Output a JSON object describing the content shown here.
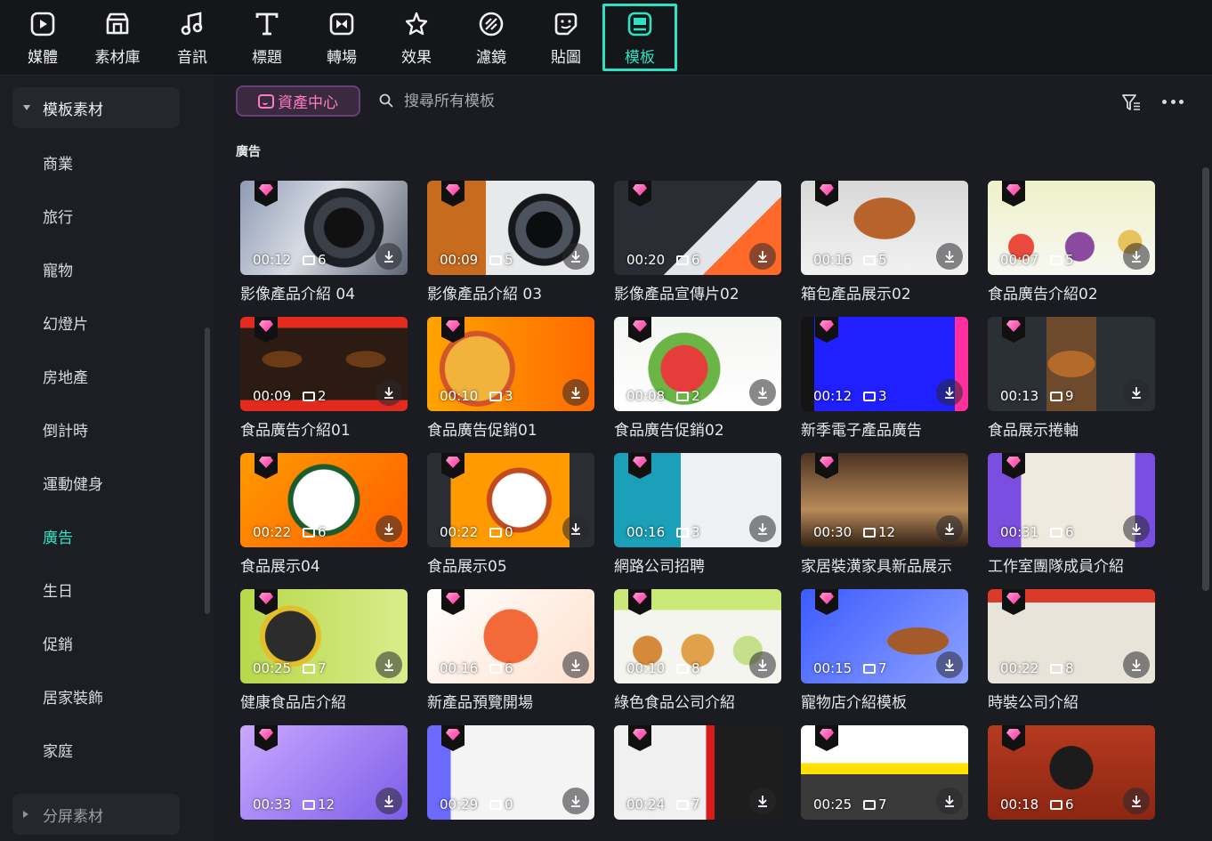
{
  "tabs": [
    {
      "label": "媒體",
      "icon": "media-icon"
    },
    {
      "label": "素材庫",
      "icon": "stock-library-icon"
    },
    {
      "label": "音訊",
      "icon": "audio-icon"
    },
    {
      "label": "標題",
      "icon": "title-icon"
    },
    {
      "label": "轉場",
      "icon": "transition-icon"
    },
    {
      "label": "效果",
      "icon": "effects-icon"
    },
    {
      "label": "濾鏡",
      "icon": "filter-icon"
    },
    {
      "label": "貼圖",
      "icon": "sticker-icon"
    },
    {
      "label": "模板",
      "icon": "template-icon",
      "active": true
    }
  ],
  "sidebar": {
    "header": "模板素材",
    "items": [
      "商業",
      "旅行",
      "寵物",
      "幻燈片",
      "房地產",
      "倒計時",
      "運動健身",
      "廣告",
      "生日",
      "促銷",
      "居家裝飾",
      "家庭"
    ],
    "active_item": "廣告",
    "footer": "分屏素材"
  },
  "toolbar": {
    "asset_center": "資產中心",
    "search_placeholder": "搜尋所有模板"
  },
  "section_title": "廣告",
  "colors": {
    "accent": "#2fe1c3",
    "premium": "#ff2f9e"
  },
  "cards": [
    {
      "title": "影像產品介紹 04",
      "duration": "00:12",
      "clips": "6"
    },
    {
      "title": "影像產品介紹 03",
      "duration": "00:09",
      "clips": "5"
    },
    {
      "title": "影像產品宣傳片02",
      "duration": "00:20",
      "clips": "6"
    },
    {
      "title": "箱包產品展示02",
      "duration": "00:16",
      "clips": "5"
    },
    {
      "title": "食品廣告介紹02",
      "duration": "00:07",
      "clips": "5"
    },
    {
      "title": "食品廣告介紹01",
      "duration": "00:09",
      "clips": "2"
    },
    {
      "title": "食品廣告促銷01",
      "duration": "00:10",
      "clips": "3"
    },
    {
      "title": "食品廣告促銷02",
      "duration": "00:08",
      "clips": "2"
    },
    {
      "title": "新季電子產品廣告",
      "duration": "00:12",
      "clips": "3"
    },
    {
      "title": "食品展示捲軸",
      "duration": "00:13",
      "clips": "9"
    },
    {
      "title": "食品展示04",
      "duration": "00:22",
      "clips": "6"
    },
    {
      "title": "食品展示05",
      "duration": "00:22",
      "clips": "0"
    },
    {
      "title": "網路公司招聘",
      "duration": "00:16",
      "clips": "3"
    },
    {
      "title": "家居裝潢家具新品展示",
      "duration": "00:30",
      "clips": "12"
    },
    {
      "title": "工作室團隊成員介紹",
      "duration": "00:31",
      "clips": "6"
    },
    {
      "title": "健康食品店介紹",
      "duration": "00:25",
      "clips": "7"
    },
    {
      "title": "新產品預覽開場",
      "duration": "00:16",
      "clips": "6"
    },
    {
      "title": "綠色食品公司介紹",
      "duration": "00:10",
      "clips": "8"
    },
    {
      "title": "寵物店介紹模板",
      "duration": "00:15",
      "clips": "7"
    },
    {
      "title": "時裝公司介紹",
      "duration": "00:22",
      "clips": "8"
    },
    {
      "title": "",
      "duration": "00:33",
      "clips": "12"
    },
    {
      "title": "",
      "duration": "00:29",
      "clips": "0"
    },
    {
      "title": "",
      "duration": "00:24",
      "clips": "7"
    },
    {
      "title": "",
      "duration": "00:25",
      "clips": "7"
    },
    {
      "title": "",
      "duration": "00:18",
      "clips": "6"
    }
  ]
}
